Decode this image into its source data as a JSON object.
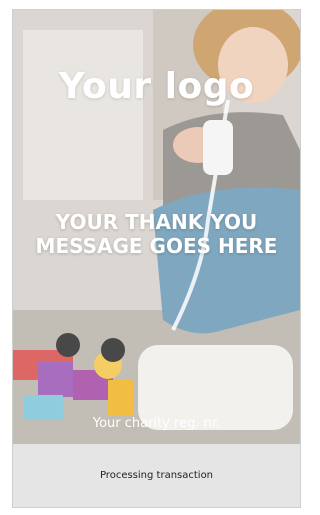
{
  "hero": {
    "logo_text": "Your logo",
    "message": "YOUR THANK YOU MESSAGE GOES HERE",
    "charity_reg": "Your charity reg. nr."
  },
  "status": {
    "text": "Processing transaction"
  }
}
